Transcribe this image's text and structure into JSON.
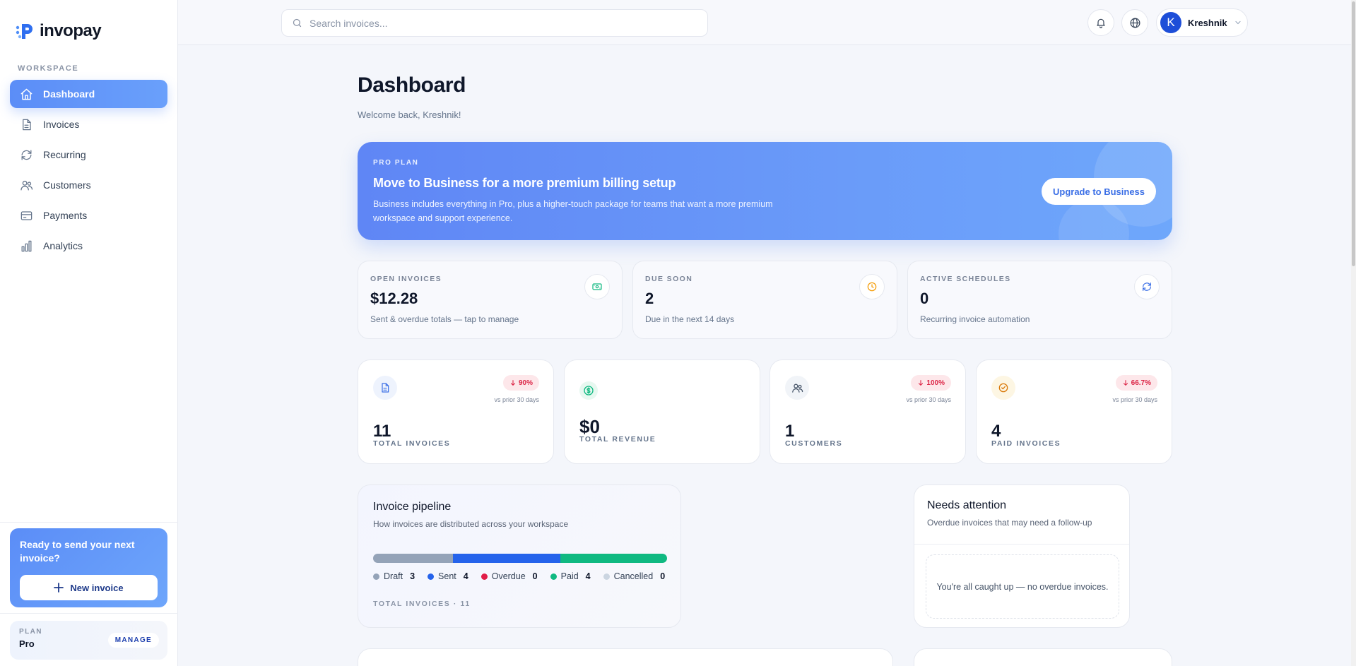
{
  "app": {
    "name": "invopay"
  },
  "sidebar": {
    "section_label": "WORKSPACE",
    "items": [
      {
        "label": "Dashboard",
        "icon": "home-icon",
        "active": true
      },
      {
        "label": "Invoices",
        "icon": "document-icon"
      },
      {
        "label": "Recurring",
        "icon": "refresh-icon"
      },
      {
        "label": "Customers",
        "icon": "users-icon"
      },
      {
        "label": "Payments",
        "icon": "credit-card-icon"
      },
      {
        "label": "Analytics",
        "icon": "bar-chart-icon"
      }
    ],
    "cta": {
      "title": "Ready to send your next invoice?",
      "button_label": "New invoice"
    },
    "plan": {
      "label": "PLAN",
      "name": "Pro",
      "manage_label": "MANAGE"
    }
  },
  "topbar": {
    "search_placeholder": "Search invoices...",
    "user": {
      "initial": "K",
      "name": "Kreshnik"
    }
  },
  "page": {
    "title": "Dashboard",
    "subtitle": "Welcome back, Kreshnik!"
  },
  "banner": {
    "kicker": "PRO PLAN",
    "title": "Move to Business for a more premium billing setup",
    "text": "Business includes everything in Pro, plus a higher-touch package for teams that want a more premium workspace and support experience.",
    "button_label": "Upgrade to Business"
  },
  "stats": [
    {
      "label": "OPEN INVOICES",
      "value": "$12.28",
      "sub": "Sent & overdue totals — tap to manage",
      "icon": "money-icon",
      "color": "#10b981"
    },
    {
      "label": "DUE SOON",
      "value": "2",
      "sub": "Due in the next 14 days",
      "icon": "clock-icon",
      "color": "#f59e0b"
    },
    {
      "label": "ACTIVE SCHEDULES",
      "value": "0",
      "sub": "Recurring invoice automation",
      "icon": "refresh-icon",
      "color": "#3b6fe6"
    }
  ],
  "kpis": [
    {
      "label": "TOTAL INVOICES",
      "value": "11",
      "badge": "90%",
      "note": "vs prior 30 days",
      "icon": "document-icon",
      "icon_color": "#3b6fe6",
      "icon_bg": "#eef3fd"
    },
    {
      "label": "TOTAL REVENUE",
      "value": "$0",
      "badge": "",
      "note": "",
      "icon": "dollar-icon",
      "icon_color": "#10b981",
      "icon_bg": "#e7f8f0"
    },
    {
      "label": "CUSTOMERS",
      "value": "1",
      "badge": "100%",
      "note": "vs prior 30 days",
      "icon": "users-icon",
      "icon_color": "#475569",
      "icon_bg": "#f1f4f8"
    },
    {
      "label": "PAID INVOICES",
      "value": "4",
      "badge": "66.7%",
      "note": "vs prior 30 days",
      "icon": "check-circle-icon",
      "icon_color": "#d97706",
      "icon_bg": "#fdf6e3"
    }
  ],
  "pipeline": {
    "title": "Invoice pipeline",
    "subtitle": "How invoices are distributed across your workspace",
    "segments": [
      {
        "label": "Draft",
        "count": 3,
        "color": "#94a3b8"
      },
      {
        "label": "Sent",
        "count": 4,
        "color": "#2563eb"
      },
      {
        "label": "Overdue",
        "count": 0,
        "color": "#e11d48"
      },
      {
        "label": "Paid",
        "count": 4,
        "color": "#10b981"
      },
      {
        "label": "Cancelled",
        "count": 0,
        "color": "#cbd5e1"
      }
    ],
    "total_label": "TOTAL INVOICES · 11"
  },
  "attention": {
    "title": "Needs attention",
    "subtitle": "Overdue invoices that may need a follow-up",
    "empty_text": "You're all caught up — no overdue invoices."
  }
}
